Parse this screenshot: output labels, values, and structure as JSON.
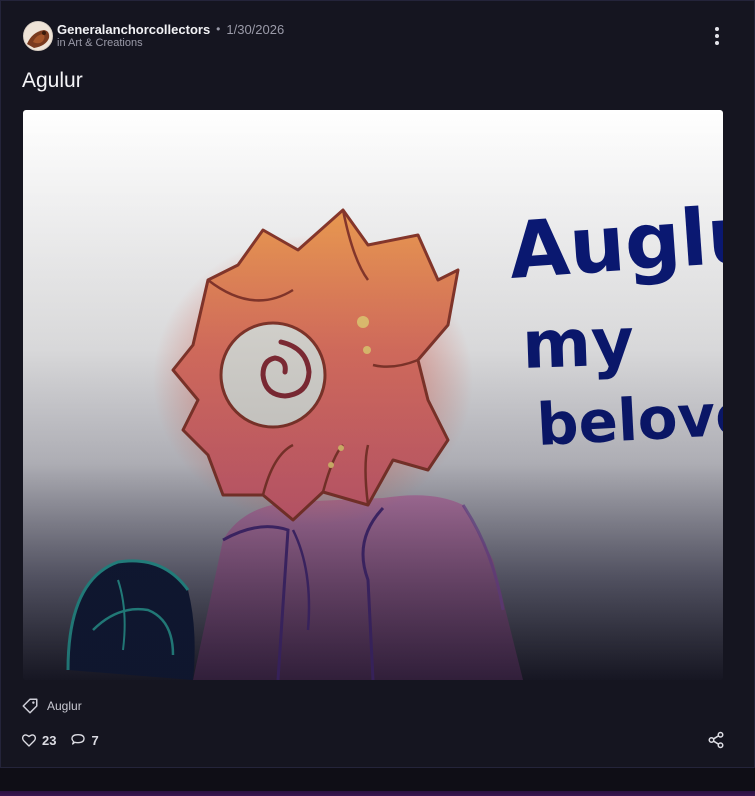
{
  "post": {
    "author": "Generalanchorcollectors",
    "date": "1/30/2026",
    "community": "in Art & Creations",
    "title": "Agulur",
    "image_text": [
      "Auglur",
      "my",
      "beloved"
    ],
    "tag": "Auglur",
    "likes": "23",
    "comments": "7"
  },
  "icons": {
    "menu": "kebab-menu-icon",
    "tag": "tag-icon",
    "like": "heart-icon",
    "comment": "comment-icon",
    "share": "share-icon"
  },
  "colors": {
    "background": "#151520",
    "text": "#f4f4f7",
    "muted": "#9a9aa8",
    "handwriting": "#0b1a7a"
  }
}
